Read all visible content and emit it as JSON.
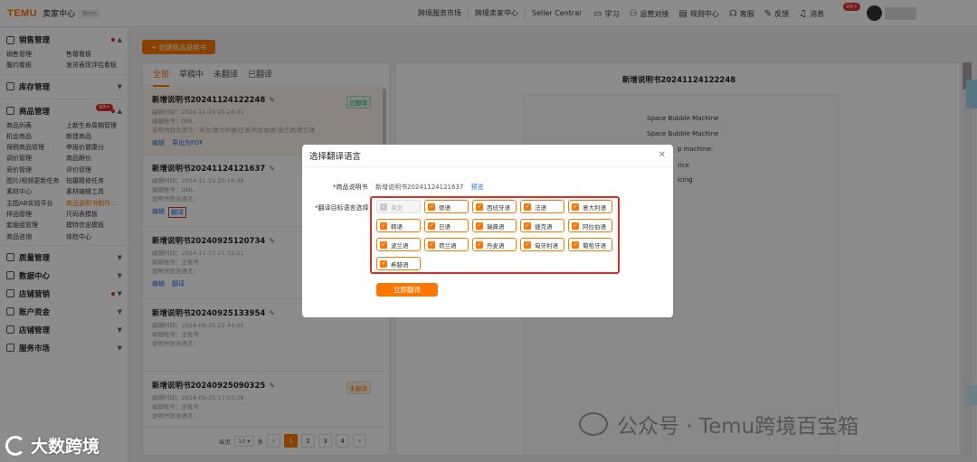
{
  "topbar": {
    "logo": "TEMU",
    "seller_center": "卖家中心",
    "beta": "Beta",
    "links": [
      "跨境服务市场",
      "跨境卖家中心",
      "Seller Central"
    ],
    "tools": [
      "学习",
      "运营对接",
      "规则中心",
      "客服",
      "反馈",
      "消息"
    ],
    "message_count": "99+"
  },
  "sidebar": {
    "sections": [
      {
        "title": "销售管理",
        "items": [
          "销售管理",
          "售罄看板",
          "履约看板",
          "发货表现评估看板"
        ]
      },
      {
        "title": "库存管理",
        "items": []
      },
      {
        "title": "商品管理",
        "hot": "99+",
        "items": [
          "商品列表",
          "上新生命周期管理",
          "机会商品",
          "新建商品",
          "保税商品管理",
          "申报价健康分",
          "调价管理",
          "商品跟价",
          "竞价管理",
          "评价管理",
          "图片/视频更新任务",
          "拍摄精修任务",
          "素材中心",
          "素材编辑工具",
          "主图AB实验平台",
          "商品说明书制作...",
          "样品管理",
          "尺码表模板",
          "套版组管理",
          "模特信息模板",
          "商品咨询",
          "体检中心"
        ]
      },
      {
        "title": "质量管理"
      },
      {
        "title": "数据中心"
      },
      {
        "title": "店铺营销"
      },
      {
        "title": "账户资金"
      },
      {
        "title": "店铺管理"
      },
      {
        "title": "服务市场"
      }
    ]
  },
  "create_button": "+ 创建商品说明书",
  "tabs": [
    "全部",
    "草稿中",
    "未翻译",
    "已翻译"
  ],
  "cards": [
    {
      "title": "新增说明书20241124122248",
      "time": "编辑时间：2024-11-24 20:28:41",
      "account": "编辑账号：DNL",
      "langs": "说明书包含语言：英文/意大利语/日语/阿拉伯语/波兰语/荷兰语",
      "badge": "已翻译",
      "actions": [
        "编辑",
        "导出为PDF"
      ]
    },
    {
      "title": "新增说明书20241124121637",
      "time": "编辑时间：2024-11-24 20:16:38",
      "account": "编辑账号：DNL",
      "langs": "说明书包含语言：-",
      "badge": "",
      "actions": [
        "编辑",
        "翻译"
      ]
    },
    {
      "title": "新增说明书20240925120734",
      "time": "编辑时间：2024-11-13 21:32:21",
      "account": "编辑账号：主账号",
      "langs": "说明书包含语言：-",
      "badge": "",
      "actions": [
        "编辑",
        "翻译"
      ]
    },
    {
      "title": "新增说明书20240925133954",
      "time": "编辑时间：2024-09-25 22:44:05",
      "account": "编辑账号：主账号",
      "langs": "说明书包含语言：-",
      "badge": "",
      "actions": []
    },
    {
      "title": "新增说明书20240925090325",
      "time": "编辑时间：2024-09-25 17:03:28",
      "account": "编辑账号：主账号",
      "langs": "说明书包含语言：-",
      "badge": "未翻译",
      "actions": []
    }
  ],
  "pager": {
    "per_page_label": "每页",
    "per_page": "10",
    "unit": "条",
    "pages": [
      "1",
      "2",
      "3",
      "4"
    ],
    "prev": "‹",
    "next": "›"
  },
  "preview": {
    "title": "新增说明书20241124122248",
    "lines": [
      "Space Bubble Machine",
      "Space Bubble Machine",
      "p machine:",
      "rice",
      "icing"
    ]
  },
  "modal": {
    "title": "选择翻译语言",
    "doc_label": "*商品说明书",
    "doc_name": "新增说明书20241124121637",
    "preview_link": "预览",
    "lang_label": "*翻译目标语言选择",
    "languages": [
      "英文",
      "德语",
      "西班牙语",
      "法语",
      "意大利语",
      "韩语",
      "日语",
      "瑞典语",
      "捷克语",
      "阿拉伯语",
      "波兰语",
      "荷兰语",
      "丹麦语",
      "匈牙利语",
      "葡萄牙语",
      "希腊语"
    ],
    "translate_button": "立即翻译"
  },
  "watermarks": {
    "left": "大数跨境",
    "right": "公众号 · Temu跨境百宝箱"
  }
}
